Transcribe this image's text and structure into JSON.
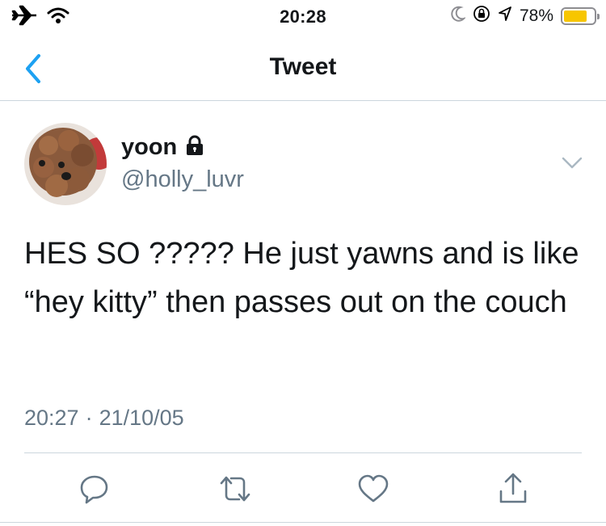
{
  "status_bar": {
    "time": "20:28",
    "battery_percent": "78%",
    "battery_level": 0.78,
    "battery_color": "#f7c600",
    "icons": [
      "airplane-icon",
      "wifi-icon",
      "moon-icon",
      "rotation-lock-icon",
      "location-arrow-icon",
      "battery-icon"
    ]
  },
  "nav": {
    "title": "Tweet",
    "back_icon": "chevron-left-icon"
  },
  "tweet": {
    "author_name": "yoon",
    "author_handle": "@holly_luvr",
    "protected_icon": "lock-icon",
    "text": "HES SO ????? He just yawns and is like “hey kitty” then passes out on the couch",
    "time": "20:27",
    "separator": "·",
    "date": "21/10/05"
  },
  "actions": [
    "reply-icon",
    "retweet-icon",
    "like-icon",
    "share-icon"
  ],
  "colors": {
    "accent": "#1da1f2",
    "secondary_text": "#657786",
    "primary_text": "#14171a",
    "divider": "#ccd6dd"
  }
}
